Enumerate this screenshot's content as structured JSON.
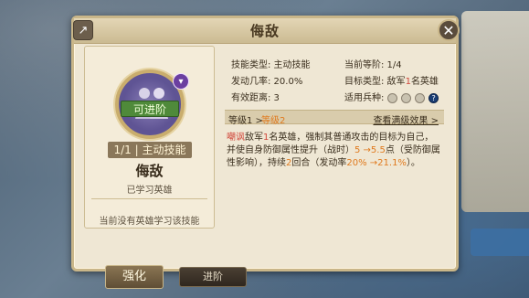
{
  "dialog": {
    "title": "侮敌"
  },
  "left": {
    "advance_label": "可进阶",
    "skill_level": "1/1 | 主动技能",
    "skill_name": "侮敌",
    "learned_label": "已学习英雄",
    "no_hero_text": "当前没有英雄学习该技能"
  },
  "info": {
    "skill_type": "技能类型: 主动技能",
    "current_level": "当前等阶: 1/4",
    "trigger_rate": "发动几率: 20.0%",
    "target_prefix": "目标类型: 敌军",
    "target_num": "1",
    "target_suffix": "名英雄",
    "range": "有效距离: 3",
    "troops_label": "适用兵种:",
    "help_glyph": "?"
  },
  "level": {
    "current": "等级1 >",
    "next": "等级2",
    "view_max": "查看满级效果 >"
  },
  "description": {
    "p1_red": "嘲讽",
    "p1_a": "敌军",
    "p1_red2": "1",
    "p1_b": "名英雄，强制其普通攻击的目标为自己，并使自身防御属性提升（战时）",
    "p1_orange": "5 →5.5",
    "p1_c": "点（受防御属性影响），持续",
    "p1_orange2": "2",
    "p1_d": "回合（发动率",
    "p1_orange3": "20% →21.1%",
    "p1_e": "）。"
  },
  "tabs": {
    "strengthen": "强化",
    "advance": "进阶"
  },
  "icons": {
    "share": "share-icon",
    "close": "close-icon",
    "chevron": "chevron-down-icon"
  },
  "colors": {
    "accent_red": "#d0463a",
    "accent_orange": "#e07a1e",
    "panel_bg": "#efe7d4"
  }
}
